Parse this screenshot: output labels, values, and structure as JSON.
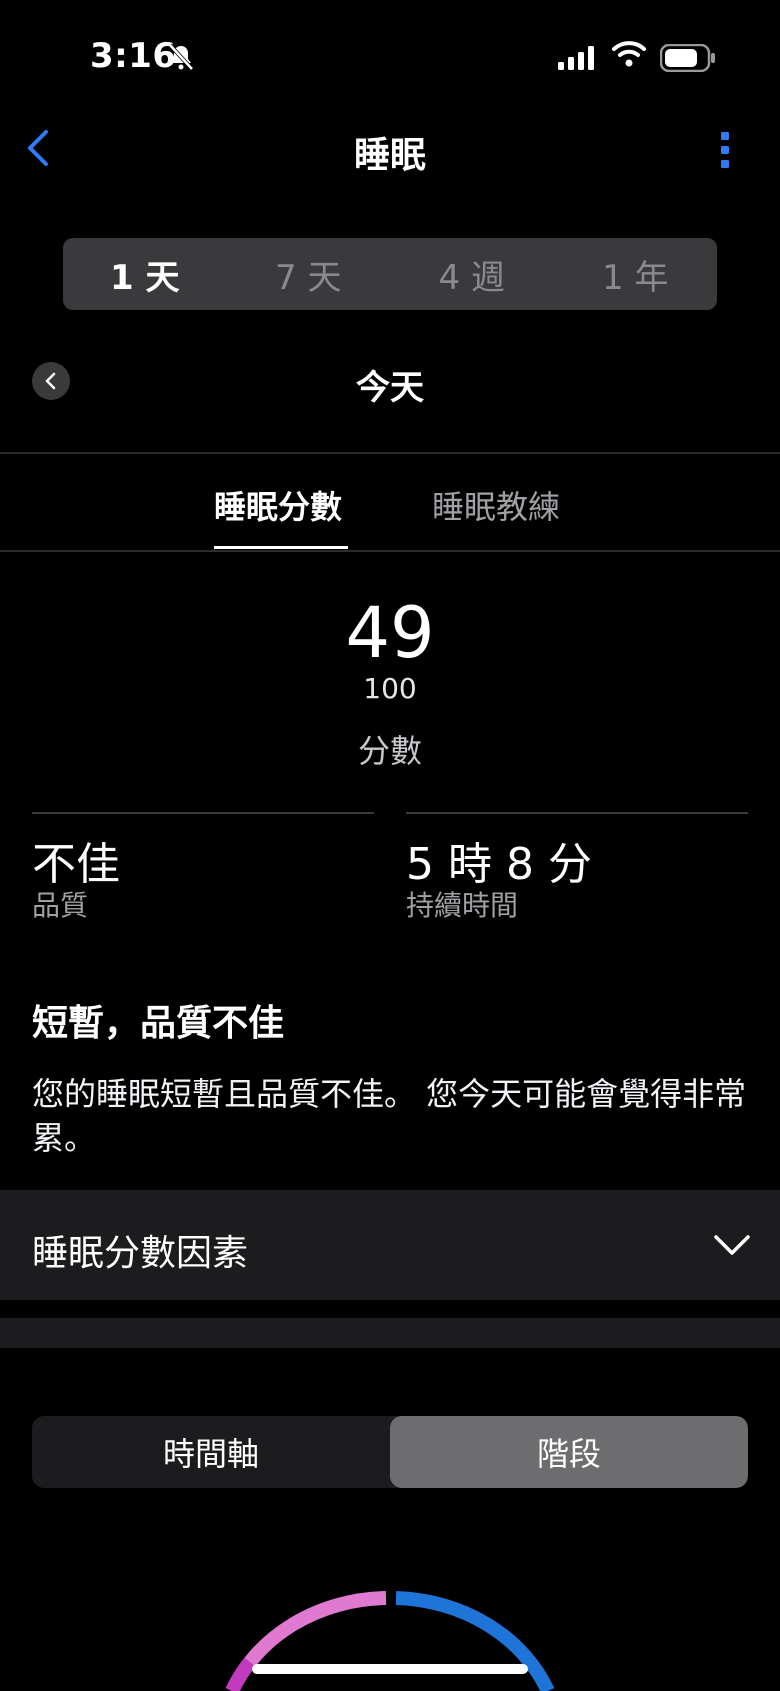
{
  "status_bar": {
    "time": "3:16"
  },
  "nav": {
    "title": "睡眠"
  },
  "periods": [
    {
      "label": "1 天",
      "active": true
    },
    {
      "label": "7 天",
      "active": false
    },
    {
      "label": "4 週",
      "active": false
    },
    {
      "label": "1 年",
      "active": false
    }
  ],
  "date_label": "今天",
  "tabs": [
    {
      "label": "睡眠分數",
      "active": true
    },
    {
      "label": "睡眠教練",
      "active": false
    }
  ],
  "score": {
    "value": "49",
    "max": "100",
    "label": "分數"
  },
  "quality": {
    "value": "不佳",
    "label": "品質"
  },
  "duration": {
    "value": "5 時 8 分",
    "label": "持續時間"
  },
  "summary": {
    "title": "短暫，品質不佳",
    "body": "您的睡眠短暫且品質不佳。 您今天可能會覺得非常累。"
  },
  "factors_label": "睡眠分數因素",
  "view_toggle": [
    {
      "label": "時間軸",
      "active": false
    },
    {
      "label": "階段",
      "active": true
    }
  ],
  "colors": {
    "accent": "#2f7cf6",
    "ring_pink": "#e07ad0",
    "ring_blue": "#1f74d8",
    "ring_magenta": "#c23bbf"
  }
}
